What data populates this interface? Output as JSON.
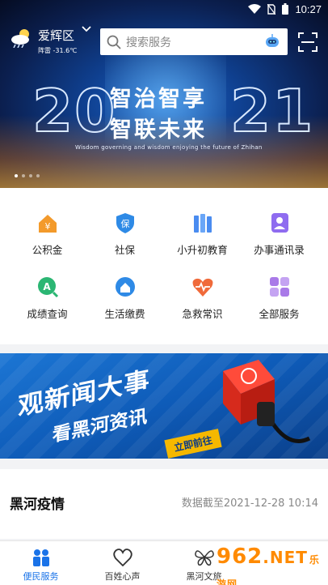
{
  "status_bar": {
    "time": "10:27"
  },
  "header": {
    "location": "爱辉区",
    "weather": "阵雷 -31.6℃",
    "search_placeholder": "搜索服务"
  },
  "hero": {
    "year_left": "20",
    "year_right": "21",
    "slogan_line1": "智治智享",
    "slogan_line2": "智联未来",
    "subtitle": "Wisdom governing and wisdom enjoying the future of Zhihan"
  },
  "services": [
    {
      "label": "公积金",
      "icon": "housing-fund-icon",
      "color": "#f39a2b"
    },
    {
      "label": "社保",
      "icon": "social-security-icon",
      "color": "#2e8ae6"
    },
    {
      "label": "小升初教育",
      "icon": "education-icon",
      "color": "#4a8cf0"
    },
    {
      "label": "办事通讯录",
      "icon": "contacts-icon",
      "color": "#8f6cf0"
    },
    {
      "label": "成绩查询",
      "icon": "score-query-icon",
      "color": "#2bb673"
    },
    {
      "label": "生活缴费",
      "icon": "utility-payment-icon",
      "color": "#2e8ae6"
    },
    {
      "label": "急救常识",
      "icon": "first-aid-icon",
      "color": "#f06a3a"
    },
    {
      "label": "全部服务",
      "icon": "all-services-icon",
      "color": "#a97ae8"
    }
  ],
  "promo": {
    "line1": "观新闻大事",
    "line2": "看黑河资讯",
    "button": "立即前往"
  },
  "epidemic": {
    "title": "黑河疫情",
    "updated": "数据截至2021-12-28 10:14"
  },
  "tabs": [
    {
      "label": "便民服务",
      "icon": "people-icon",
      "active": true
    },
    {
      "label": "百姓心声",
      "icon": "heart-icon",
      "active": false
    },
    {
      "label": "黑河文旅",
      "icon": "butterfly-icon",
      "active": false
    }
  ],
  "watermark": {
    "brand": "962",
    "net": ".NET",
    "site": "乐游网"
  },
  "colors": {
    "accent": "#1a73e8",
    "promo_button": "#f5b800"
  }
}
